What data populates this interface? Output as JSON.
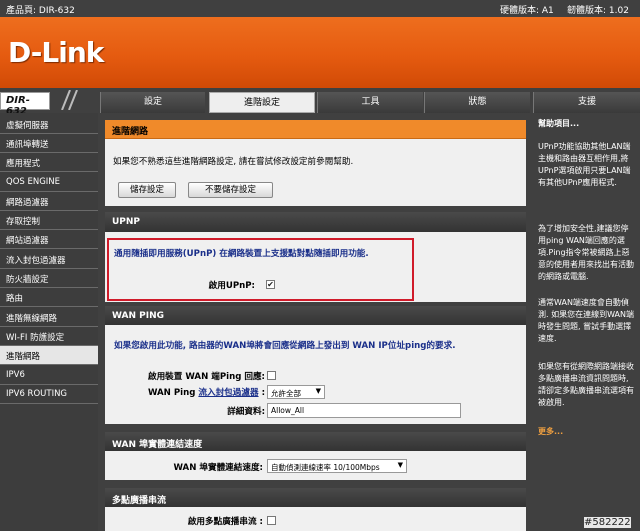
{
  "topbar": {
    "product": "產品頁: DIR-632",
    "hw_version": "硬體版本: A1",
    "fw_version": "韌體版本: 1.02"
  },
  "brand": {
    "logo_text": "D-Link",
    "model": "DIR-632"
  },
  "colors": {
    "accent": "#f08a2a",
    "nav_dark": "#404040",
    "highlight": "#d01b2a",
    "link_blue": "#1a2f8a"
  },
  "nav": {
    "tabs": [
      "設定",
      "進階設定",
      "工具",
      "狀態",
      "支援"
    ],
    "active": "進階設定"
  },
  "sidebar": {
    "items": [
      "虛擬伺服器",
      "通訊埠轉送",
      "應用程式",
      "QOS ENGINE",
      "網路過濾器",
      "存取控制",
      "網站過濾器",
      "流入封包過濾器",
      "防火牆設定",
      "路由",
      "進階無線網路",
      "WI-FI 防護設定",
      "進階網路",
      "IPV6",
      "IPV6 ROUTING"
    ],
    "selected": "進階網路"
  },
  "advanced": {
    "title": "進階網路",
    "description": "如果您不熟悉這些進階網路設定, 請在嘗試修改設定前參閱幫助.",
    "save_label": "儲存設定",
    "nosave_label": "不要儲存設定"
  },
  "upnp": {
    "title": "UPNP",
    "description": "通用隨插即用服務(UPnP) 在網路裝置上支援點對點隨插即用功能.",
    "enable_label": "啟用UPnP:",
    "enabled": true
  },
  "wanping": {
    "title": "WAN PING",
    "description": "如果您啟用此功能, 路由器的WAN埠將會回應從網路上發出到 WAN IP位址ping的要求.",
    "enable_label": "啟用裝置 WAN 端Ping 回應:",
    "filter_label_prefix": "WAN Ping",
    "filter_link": "流入封包過濾器",
    "filter_label_suffix": ":",
    "filter_value": "允許全部",
    "detail_label": "詳細資料:",
    "detail_value": "Allow_All",
    "enabled": false
  },
  "wanspeed": {
    "title": "WAN 埠實體連結速度",
    "label": "WAN 埠實體連結速度:",
    "value": "自動偵測連線速率 10/100Mbps"
  },
  "multicast": {
    "title": "多點廣播串流",
    "label": "啟用多點廣播串流 :",
    "enabled": false
  },
  "help": {
    "title": "幫助項目...",
    "p1": "UPnP功能協助其他LAN端主機和路由器互相作用,將UPnP選項啟用只要LAN端有其他UPnP應用程式.",
    "p2": "為了增加安全性,建議您停用ping WAN端回應的選項.Ping指令常被網路上惡意的使用者用來找出有活動的網路或電腦.",
    "p3": "通常WAN端速度會自動偵測. 如果您在連線到WAN端時發生問題, 嘗試手動選擇速度.",
    "p4": "如果您有從網際網路端接收多點廣播串流資訊問題時,請卻定多點廣播串流選項有被啟用.",
    "more": "更多..."
  },
  "watermark": "#582222"
}
